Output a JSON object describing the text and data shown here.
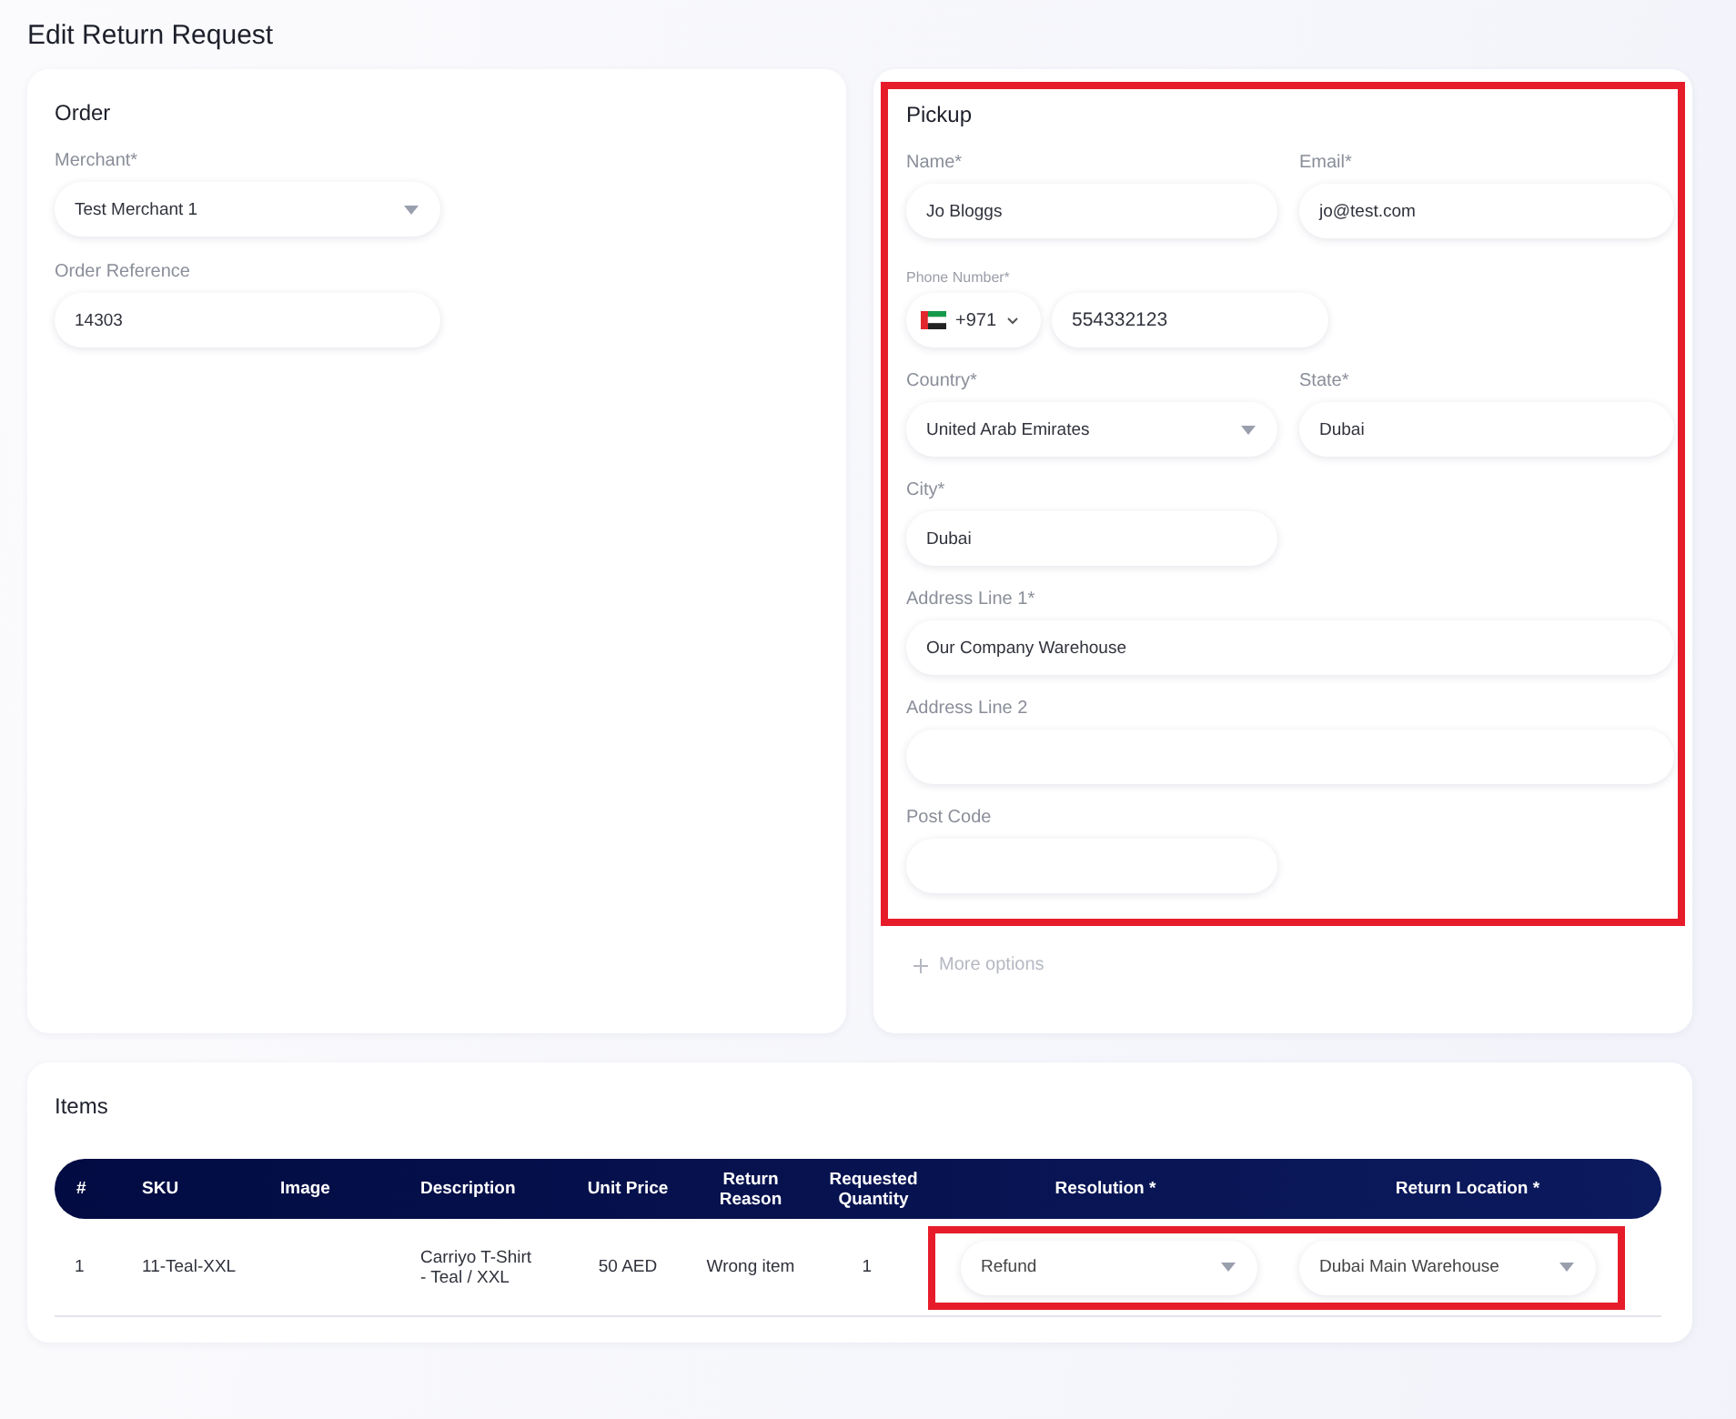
{
  "title": "Edit Return Request",
  "order": {
    "title": "Order",
    "fields": [
      {
        "label": "Merchant*",
        "value": "Test Merchant 1",
        "kind": "select"
      },
      {
        "label": "Order Reference",
        "value": "14303",
        "kind": "text"
      }
    ]
  },
  "pickup": {
    "title": "Pickup",
    "highlighted": true,
    "fields": [
      {
        "label": "Name*",
        "value": "Jo Bloggs",
        "kind": "text"
      },
      {
        "label": "Email*",
        "value": "jo@test.com",
        "kind": "text"
      },
      {
        "label": "Phone Number*",
        "country_code": "+971",
        "value": "554332123",
        "kind": "phone"
      },
      {
        "label": "Country*",
        "value": "United Arab Emirates",
        "kind": "select"
      },
      {
        "label": "State*",
        "value": "Dubai",
        "kind": "text"
      },
      {
        "label": "City*",
        "value": "Dubai",
        "kind": "text"
      },
      {
        "label": "Address Line 1*",
        "value": "Our Company Warehouse",
        "kind": "line"
      },
      {
        "label": "Address Line 2",
        "kind": "line"
      },
      {
        "label": "Post Code",
        "kind": "text"
      }
    ],
    "more_options": "More options"
  },
  "items": {
    "title": "Items",
    "columns": [
      "#",
      "SKU",
      "Image",
      "Description",
      "Unit Price",
      "Return Reason",
      "Requested Quantity",
      "Resolution *",
      "Return Location *"
    ],
    "rows": [
      {
        "cells": [
          "1",
          "11-Teal-XXL",
          "",
          "Carriyo T-Shirt - Teal / XXL",
          "50 AED",
          "Wrong item",
          "1"
        ],
        "resolution": "Refund",
        "return_location": "Dubai Main Warehouse",
        "highlighted": true
      }
    ]
  }
}
